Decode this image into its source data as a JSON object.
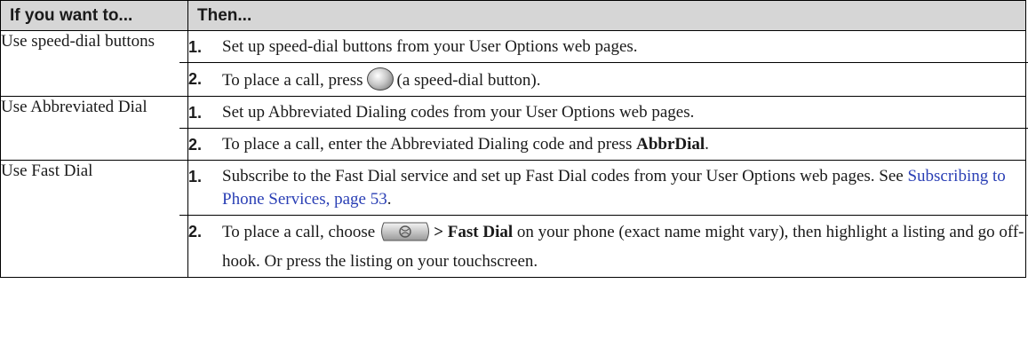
{
  "header": {
    "col1": "If you want to...",
    "col2": "Then..."
  },
  "rows": [
    {
      "task": "Use speed-dial buttons",
      "steps": [
        {
          "num": "1.",
          "text": "Set up speed-dial buttons from your User Options web pages."
        },
        {
          "num": "2.",
          "pre": "To place a call, press",
          "icon": "speed-dial-button-icon",
          "post": "(a speed-dial button)."
        }
      ]
    },
    {
      "task": "Use Abbreviated Dial",
      "steps": [
        {
          "num": "1.",
          "text": "Set up Abbreviated Dialing codes from your User Options web pages."
        },
        {
          "num": "2.",
          "pre": "To place a call, enter the Abbreviated Dialing code and press ",
          "bold": "AbbrDial",
          "post": "."
        }
      ]
    },
    {
      "task": "Use Fast Dial",
      "steps": [
        {
          "num": "1.",
          "pre": "Subscribe to the Fast Dial service and set up Fast Dial codes from your User Options web pages. See ",
          "link": "Subscribing to Phone Services, page 53",
          "post": "."
        },
        {
          "num": "2.",
          "pre": "To place a call, choose",
          "icon": "services-button-icon",
          "bold": "> Fast Dial",
          "post": " on your phone (exact name might vary), then highlight a listing and go off-hook. Or press the listing on your touchscreen."
        }
      ]
    }
  ]
}
